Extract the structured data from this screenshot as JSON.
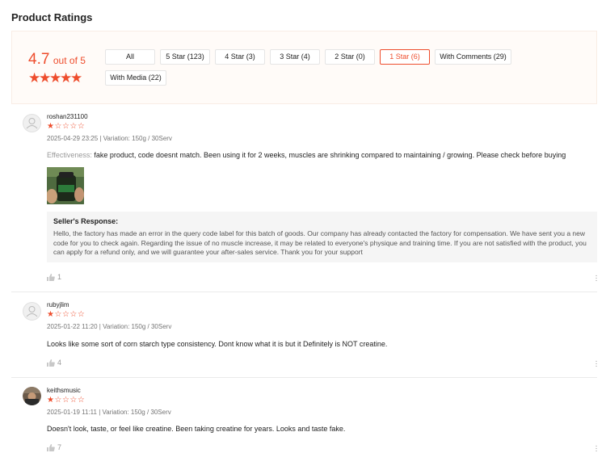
{
  "page": {
    "title": "Product Ratings"
  },
  "summary": {
    "score": "4.7",
    "out_of": "out of 5",
    "rating_value": 4.7,
    "filters": [
      {
        "label": "All",
        "active": false
      },
      {
        "label": "5 Star (123)",
        "active": false
      },
      {
        "label": "4 Star (3)",
        "active": false
      },
      {
        "label": "3 Star (4)",
        "active": false
      },
      {
        "label": "2 Star (0)",
        "active": false
      },
      {
        "label": "1 Star (6)",
        "active": true
      },
      {
        "label": "With Comments (29)",
        "active": false
      },
      {
        "label": "With Media (22)",
        "active": false
      }
    ]
  },
  "reviews": [
    {
      "username": "roshan231100",
      "rating": 1,
      "meta": "2025-04-29 23:25 | Variation: 150g / 30Serv",
      "label": "Effectiveness:",
      "text": "fake product, code doesnt match. Been using it for 2 weeks, muscles are shrinking compared to maintaining / growing. Please check before buying",
      "seller_heading": "Seller's Response:",
      "seller_text": "Hello, the factory has made an error in the query code label for this batch of goods. Our company has already contacted the factory for compensation. We have sent you a new code for you to check again. Regarding the issue of no muscle increase, it may be related to everyone's physique and training time. If you are not satisfied with the product, you can apply for a refund only, and we will guarantee your after-sales service. Thank you for your support",
      "likes": "1"
    },
    {
      "username": "rubyjlim",
      "rating": 1,
      "meta": "2025-01-22 11:20 | Variation: 150g / 30Serv",
      "text": "Looks like some sort of corn starch type consistency. Dont know what it is but it Definitely is NOT creatine.",
      "likes": "4"
    },
    {
      "username": "keithsmusic",
      "rating": 1,
      "meta": "2025-01-19 11:11 | Variation: 150g / 30Serv",
      "text": "Doesn't look, taste, or feel like creatine.   Been taking creatine for years.  Looks and taste fake.",
      "likes": "7"
    }
  ],
  "colors": {
    "accent": "#ee4d2d",
    "summary_bg": "#fffbf8",
    "seller_bg": "#f5f5f5"
  },
  "icons": {
    "like": "thumbs-up-icon",
    "more": "more-vertical-icon",
    "avatar": "user-avatar-icon"
  }
}
